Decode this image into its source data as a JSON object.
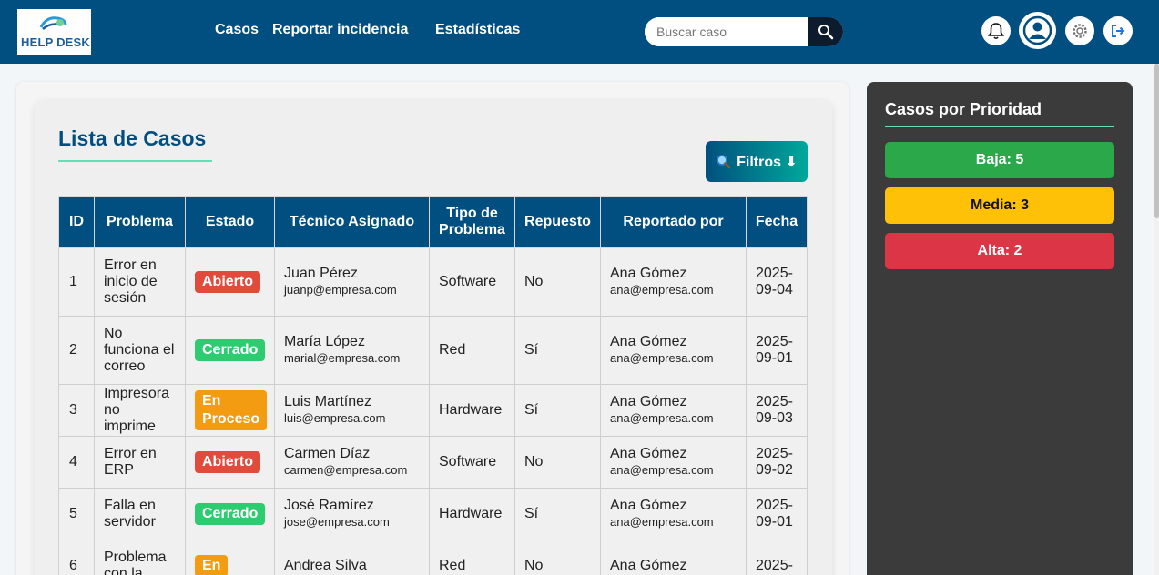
{
  "header": {
    "logo_text": "HELP DESK",
    "nav": [
      "Casos",
      "Reportar incidencia",
      "Estadísticas"
    ],
    "search_placeholder": "Buscar caso",
    "icons": [
      "bell-icon",
      "user-icon",
      "settings-icon",
      "logout-icon"
    ]
  },
  "list": {
    "title": "Lista de Casos",
    "filter_label": "Filtros ⬇",
    "columns": [
      "ID",
      "Problema",
      "Estado",
      "Técnico Asignado",
      "Tipo de Problema",
      "Repuesto",
      "Reportado por",
      "Fecha"
    ],
    "rows": [
      {
        "id": "1",
        "problem": "Error en inicio de sesión",
        "status": "Abierto",
        "tech": "Juan Pérez",
        "tech_email": "juanp@empresa.com",
        "type": "Software",
        "spare": "No",
        "reporter": "Ana Gómez",
        "reporter_email": "ana@empresa.com",
        "date": "2025-09-04"
      },
      {
        "id": "2",
        "problem": "No funciona el correo",
        "status": "Cerrado",
        "tech": "María López",
        "tech_email": "marial@empresa.com",
        "type": "Red",
        "spare": "Sí",
        "reporter": "Ana Gómez",
        "reporter_email": "ana@empresa.com",
        "date": "2025-09-01"
      },
      {
        "id": "3",
        "problem": "Impresora no imprime",
        "status": "En Proceso",
        "tech": "Luis Martínez",
        "tech_email": "luis@empresa.com",
        "type": "Hardware",
        "spare": "Sí",
        "reporter": "Ana Gómez",
        "reporter_email": "ana@empresa.com",
        "date": "2025-09-03"
      },
      {
        "id": "4",
        "problem": "Error en ERP",
        "status": "Abierto",
        "tech": "Carmen Díaz",
        "tech_email": "carmen@empresa.com",
        "type": "Software",
        "spare": "No",
        "reporter": "Ana Gómez",
        "reporter_email": "ana@empresa.com",
        "date": "2025-09-02"
      },
      {
        "id": "5",
        "problem": "Falla en servidor",
        "status": "Cerrado",
        "tech": "José Ramírez",
        "tech_email": "jose@empresa.com",
        "type": "Hardware",
        "spare": "Sí",
        "reporter": "Ana Gómez",
        "reporter_email": "ana@empresa.com",
        "date": "2025-09-01"
      },
      {
        "id": "6",
        "problem": "Problema con la",
        "status": "En",
        "tech": "Andrea Silva",
        "tech_email": "",
        "type": "Red",
        "spare": "No",
        "reporter": "Ana Gómez",
        "reporter_email": "",
        "date": "2025-"
      }
    ]
  },
  "status_colors": {
    "Abierto": "#e04b3c",
    "Cerrado": "#2ecc71",
    "En Proceso": "#f39c12",
    "En": "#f39c12"
  },
  "sidebar": {
    "title": "Casos por Prioridad",
    "priorities": [
      {
        "label": "Baja: 5",
        "color": "#2aa84a",
        "text_color": "#ffffff"
      },
      {
        "label": "Media: 3",
        "color": "#ffc107",
        "text_color": "#111111"
      },
      {
        "label": "Alta: 2",
        "color": "#dc3545",
        "text_color": "#ffffff"
      }
    ]
  }
}
